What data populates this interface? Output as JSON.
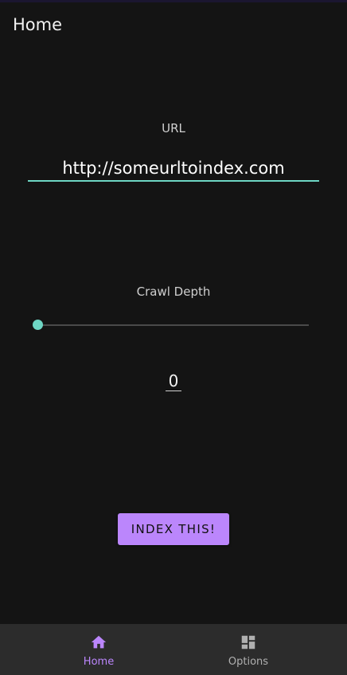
{
  "app_bar": {
    "title": "Home"
  },
  "url_section": {
    "label": "URL",
    "value": "http://someurltoindex.com"
  },
  "depth_section": {
    "label": "Crawl Depth",
    "slider_value": 0,
    "value_text": "0"
  },
  "actions": {
    "index_button": "INDEX THIS!"
  },
  "bottom_nav": {
    "items": [
      {
        "label": "Home",
        "icon": "home-icon",
        "selected": true
      },
      {
        "label": "Options",
        "icon": "dashboard-icon",
        "selected": false
      }
    ]
  },
  "colors": {
    "background": "#141414",
    "accent": "#6ed6c4",
    "primary": "#bb86fc",
    "nav_background": "#2c2c2c"
  }
}
